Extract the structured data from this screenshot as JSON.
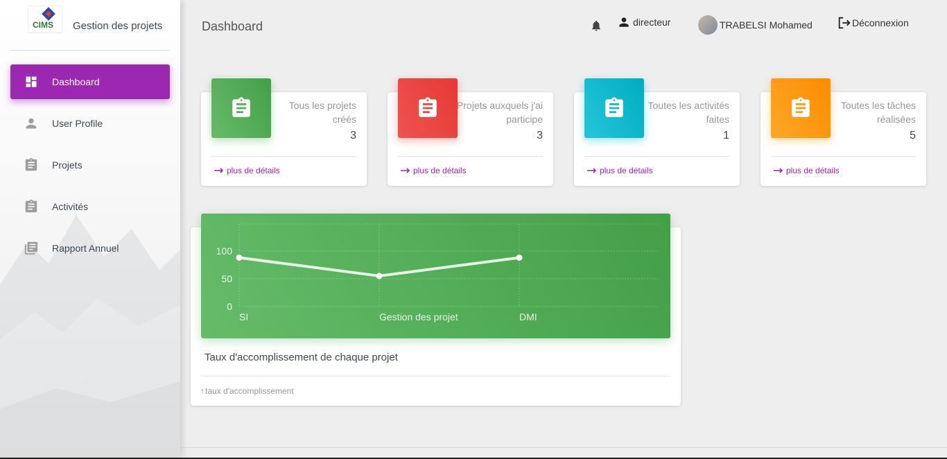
{
  "sidebar": {
    "logo_text": "CIMS",
    "brand": "Gestion des projets",
    "items": [
      {
        "label": "Dashboard",
        "icon": "dashboard-icon",
        "active": true
      },
      {
        "label": "User Profile",
        "icon": "person-icon"
      },
      {
        "label": "Projets",
        "icon": "clipboard-icon"
      },
      {
        "label": "Activités",
        "icon": "clipboard-icon"
      },
      {
        "label": "Rapport Annuel",
        "icon": "library-books-icon"
      }
    ]
  },
  "header": {
    "title": "Dashboard",
    "notification_icon": "bell-icon",
    "role": "directeur",
    "user_name": "TRABELSI Mohamed",
    "logout": "Déconnexion"
  },
  "stats": [
    {
      "label": "Tous les projets créés",
      "value": "3",
      "footer": "plus de détails",
      "color": "#4caf50"
    },
    {
      "label": "Projets auxquels j'ai participe",
      "value": "3",
      "footer": "plus de détails",
      "color": "#f44336"
    },
    {
      "label": "Toutes les activités faites",
      "value": "1",
      "footer": "plus de détails",
      "color": "#00bcd4"
    },
    {
      "label": "Toutes les tâches réalisées",
      "value": "5",
      "footer": "plus de détails",
      "color": "#ff9800"
    }
  ],
  "chart": {
    "title": "Taux d'accomplissement de chaque projet",
    "footer": "taux d'accomplissement"
  },
  "chart_data": {
    "type": "line",
    "categories": [
      "SI",
      "Gestion des projet",
      "DMI"
    ],
    "values": [
      88,
      55,
      88
    ],
    "ylim": [
      0,
      100
    ],
    "yticks": [
      "0",
      "50",
      "100"
    ],
    "grid": true
  }
}
